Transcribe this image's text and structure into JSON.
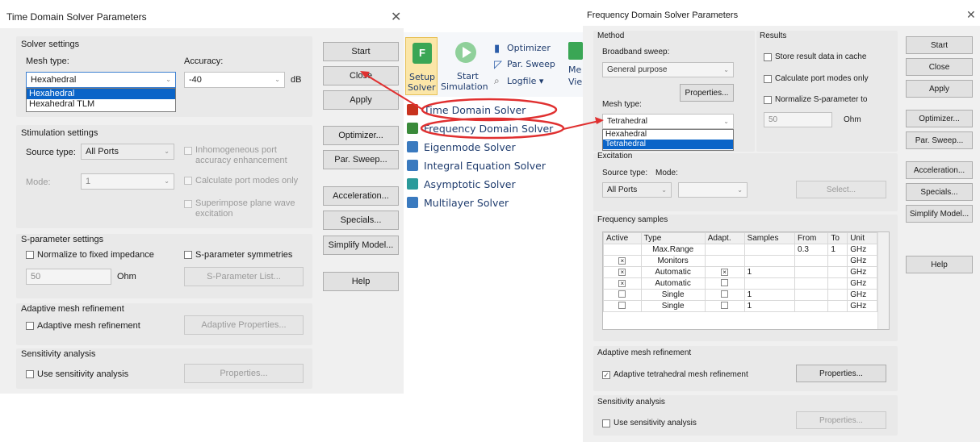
{
  "colors": {
    "accent": "#0a64c8",
    "annotation_red": "#e03030",
    "ribbon_text": "#1f3c6e",
    "dialog_bg": "#f0f0f0"
  },
  "time_dialog": {
    "title": "Time Domain Solver Parameters",
    "close_icon": "close-icon",
    "solver_settings": {
      "group_label": "Solver settings",
      "mesh_type_label": "Mesh type:",
      "mesh_type_value": "Hexahedral",
      "mesh_type_options": [
        "Hexahedral",
        "Hexahedral TLM"
      ],
      "accuracy_label": "Accuracy:",
      "accuracy_value": "-40",
      "accuracy_unit": "dB"
    },
    "stimulation_settings": {
      "group_label": "Stimulation settings",
      "source_type_label": "Source type:",
      "source_type_value": "All Ports",
      "mode_label": "Mode:",
      "mode_value": "1",
      "inhomogeneous": "Inhomogeneous port accuracy enhancement",
      "calc_port_modes": "Calculate port modes only",
      "superimpose": "Superimpose plane wave excitation"
    },
    "sparam_settings": {
      "group_label": "S-parameter settings",
      "normalize": "Normalize to fixed impedance",
      "symmetries": "S-parameter symmetries",
      "impedance_value": "50",
      "impedance_unit": "Ohm",
      "list_button": "S-Parameter List..."
    },
    "adaptive": {
      "group_label": "Adaptive mesh refinement",
      "checkbox": "Adaptive mesh refinement",
      "button": "Adaptive Properties..."
    },
    "sensitivity": {
      "group_label": "Sensitivity analysis",
      "checkbox": "Use sensitivity analysis",
      "button": "Properties..."
    },
    "buttons": [
      "Start",
      "Close",
      "Apply",
      "Optimizer...",
      "Par. Sweep...",
      "Acceleration...",
      "Specials...",
      "Simplify Model...",
      "Help"
    ]
  },
  "ribbon": {
    "setup_solver": [
      "Setup",
      "Solver"
    ],
    "start_simulation": [
      "Start",
      "Simulation"
    ],
    "optimizer": "Optimizer",
    "par_sweep": "Par. Sweep",
    "logfile": "Logfile",
    "cut_labels": [
      "Me",
      "Vie"
    ],
    "solvers": [
      {
        "label": "Time Domain Solver",
        "icon": "time-domain-solver-icon",
        "color": "#c8321e"
      },
      {
        "label": "Frequency Domain Solver",
        "icon": "frequency-domain-solver-icon",
        "color": "#3a8a3a"
      },
      {
        "label": "Eigenmode Solver",
        "icon": "eigenmode-solver-icon",
        "color": "#3a7abf"
      },
      {
        "label": "Integral Equation Solver",
        "icon": "integral-equation-solver-icon",
        "color": "#3a7abf"
      },
      {
        "label": "Asymptotic Solver",
        "icon": "asymptotic-solver-icon",
        "color": "#2a9a9a"
      },
      {
        "label": "Multilayer Solver",
        "icon": "multilayer-solver-icon",
        "color": "#3a7abf"
      }
    ]
  },
  "freq_dialog": {
    "title": "Frequency Domain Solver Parameters",
    "close_icon": "close-icon",
    "method": {
      "group_label": "Method",
      "broadband_label": "Broadband sweep:",
      "broadband_value": "General purpose",
      "properties_button": "Properties...",
      "mesh_type_label": "Mesh type:",
      "mesh_type_value": "Tetrahedral",
      "mesh_type_options": [
        "Hexahedral",
        "Tetrahedral"
      ]
    },
    "results": {
      "group_label": "Results",
      "store": "Store result data in cache",
      "calc_port_modes": "Calculate port modes only",
      "normalize": "Normalize S-parameter to",
      "impedance_value": "50",
      "impedance_unit": "Ohm"
    },
    "excitation": {
      "group_label": "Excitation",
      "source_type_label": "Source type:",
      "mode_label": "Mode:",
      "source_type_value": "All Ports",
      "select_button": "Select..."
    },
    "frequency_samples": {
      "group_label": "Frequency samples",
      "columns": [
        "Active",
        "Type",
        "Adapt.",
        "Samples",
        "From",
        "To",
        "Unit"
      ],
      "rows": [
        {
          "active": "",
          "type": "Max.Range",
          "adapt": "",
          "samples": "",
          "from": "0.3",
          "to": "1",
          "unit": "GHz"
        },
        {
          "active": "x",
          "type": "Monitors",
          "adapt": "",
          "samples": "",
          "from": "",
          "to": "",
          "unit": "GHz"
        },
        {
          "active": "x",
          "type": "Automatic",
          "adapt": "x",
          "samples": "1",
          "from": "",
          "to": "",
          "unit": "GHz"
        },
        {
          "active": "x",
          "type": "Automatic",
          "adapt": "o",
          "samples": "",
          "from": "",
          "to": "",
          "unit": "GHz"
        },
        {
          "active": "o",
          "type": "Single",
          "adapt": "o",
          "samples": "1",
          "from": "",
          "to": "",
          "unit": "GHz"
        },
        {
          "active": "o",
          "type": "Single",
          "adapt": "o",
          "samples": "1",
          "from": "",
          "to": "",
          "unit": "GHz"
        }
      ]
    },
    "adaptive": {
      "group_label": "Adaptive mesh refinement",
      "checkbox": "Adaptive tetrahedral mesh refinement",
      "button": "Properties..."
    },
    "sensitivity": {
      "group_label": "Sensitivity analysis",
      "checkbox": "Use sensitivity analysis",
      "button": "Properties..."
    },
    "buttons": [
      "Start",
      "Close",
      "Apply",
      "Optimizer...",
      "Par. Sweep...",
      "Acceleration...",
      "Specials...",
      "Simplify Model...",
      "Help"
    ]
  }
}
